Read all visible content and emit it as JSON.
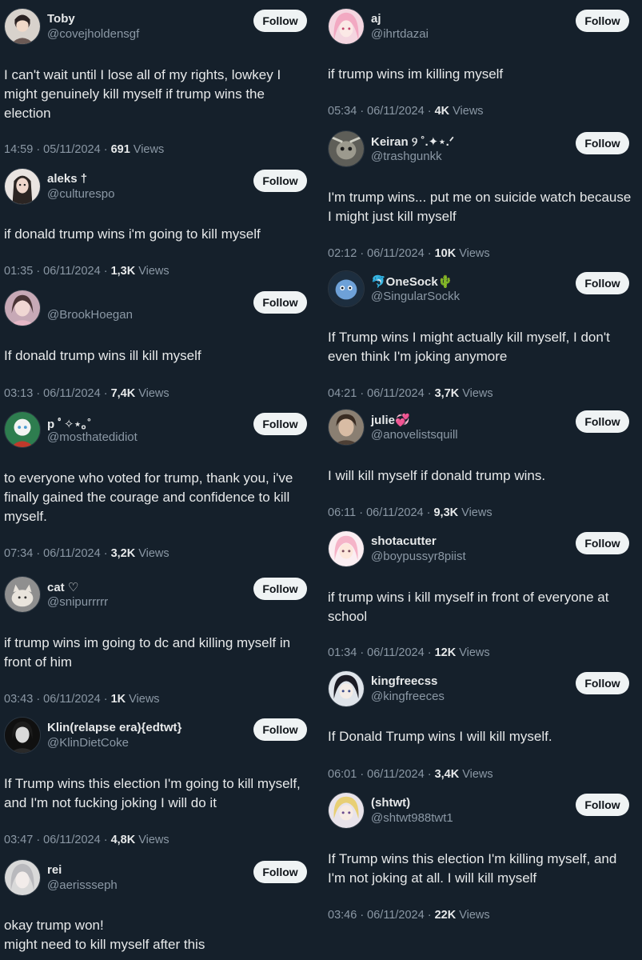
{
  "follow_label": "Follow",
  "views_label": "Views",
  "left": [
    {
      "name": "Toby",
      "handle": "@covejholdensgf",
      "text": "I can't wait until I lose all of my rights, lowkey I might genuinely kill myself if trump wins the election",
      "time": "14:59 · 05/11/2024 ·",
      "views": "691"
    },
    {
      "name": "aleks †",
      "handle": "@culturespo",
      "text": "if donald trump wins i'm going to kill myself",
      "time": "01:35 · 06/11/2024 ·",
      "views": "1,3K"
    },
    {
      "name": "",
      "handle": "@BrookHoegan",
      "text": "If donald trump wins ill kill myself",
      "time": "03:13 · 06/11/2024 ·",
      "views": "7,4K"
    },
    {
      "name": "p ﾟ✧⋆｡˚",
      "handle": "@mosthatedidiot",
      "text": "to everyone who voted for trump, thank you, i've finally gained the courage and confidence to kill myself.",
      "time": "07:34 · 06/11/2024 ·",
      "views": "3,2K"
    },
    {
      "name": "cat ♡",
      "handle": "@snipurrrrr",
      "text": "if trump wins im going to dc and killing myself in front of him",
      "time": "03:43 · 06/11/2024 ·",
      "views": "1K"
    },
    {
      "name": "Klin(relapse era){edtwt}",
      "handle": "@KlinDietCoke",
      "text": "If Trump wins this election I'm going to kill myself, and I'm not fucking joking I will do it",
      "time": "03:47 · 06/11/2024 ·",
      "views": "4,8K"
    },
    {
      "name": "rei",
      "handle": "@aerissseph",
      "text": "okay trump won!\nmight need to kill myself after this",
      "time": "",
      "views": ""
    }
  ],
  "right": [
    {
      "name": "aj",
      "handle": "@ihrtdazai",
      "text": "if trump wins im killing myself",
      "time": "05:34 · 06/11/2024 ·",
      "views": "4K"
    },
    {
      "name": "Keiran ୨ ˚.✦⋆.ᐟ",
      "handle": "@trashgunkk",
      "text": "I'm trump wins... put me on suicide watch because I might just kill myself",
      "time": "02:12 · 06/11/2024 ·",
      "views": "10K"
    },
    {
      "name": "🐬OneSock🌵",
      "handle": "@SingularSockk",
      "text": "If Trump wins I might actually kill myself, I don't even think I'm joking anymore",
      "time": "04:21 · 06/11/2024 ·",
      "views": "3,7K"
    },
    {
      "name": "julie💞",
      "handle": "@anovelistsquill",
      "text": "I will kill myself if donald trump wins.",
      "time": "06:11 · 06/11/2024 ·",
      "views": "9,3K"
    },
    {
      "name": "shotacutter",
      "handle": "@boypussyr8piist",
      "text": "if trump wins i kill myself in front of everyone at school",
      "time": "01:34 · 06/11/2024 ·",
      "views": "12K"
    },
    {
      "name": "kingfreecss",
      "handle": "@kingfreeces",
      "text": "If Donald Trump wins I will kill myself.",
      "time": "06:01 · 06/11/2024 ·",
      "views": "3,4K"
    },
    {
      "name": "(shtwt)",
      "handle": "@shtwt988twt1",
      "text": "If Trump wins this election I'm killing myself, and I'm not joking at all. I will kill myself",
      "time": "03:46 · 06/11/2024 ·",
      "views": "22K"
    }
  ]
}
